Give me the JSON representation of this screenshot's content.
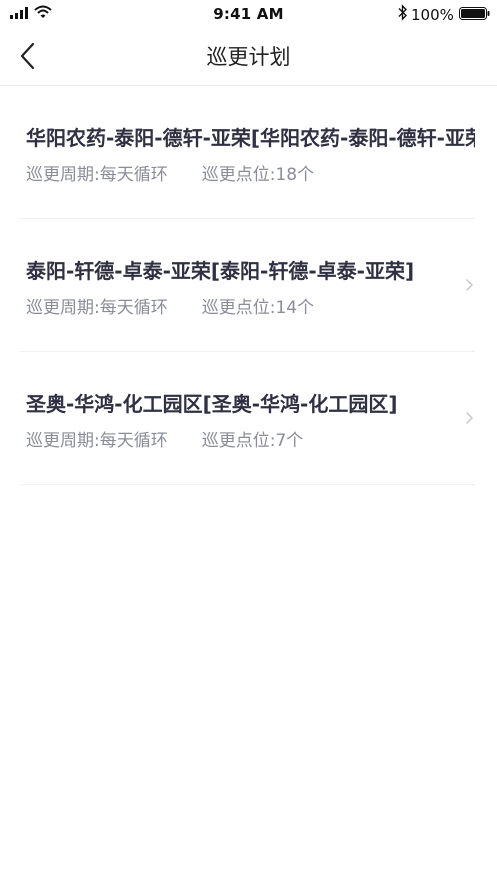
{
  "status_bar": {
    "time": "9:41 AM",
    "battery": "100%"
  },
  "nav": {
    "title": "巡更计划"
  },
  "plans": [
    {
      "title": "华阳农药-泰阳-德轩-亚荣[华阳农药-泰阳-德轩-亚荣]",
      "cycle": "巡更周期:每天循环",
      "points": "巡更点位:18个"
    },
    {
      "title": "泰阳-轩德-卓泰-亚荣[泰阳-轩德-卓泰-亚荣]",
      "cycle": "巡更周期:每天循环",
      "points": "巡更点位:14个"
    },
    {
      "title": "圣奥-华鸿-化工园区[圣奥-华鸿-化工园区]",
      "cycle": "巡更周期:每天循环",
      "points": "巡更点位:7个"
    }
  ],
  "colors": {
    "title_text": "#2f3142",
    "meta_text": "#8a8c98",
    "divider": "#f0f0f3",
    "chevron": "#c8c8cd"
  }
}
